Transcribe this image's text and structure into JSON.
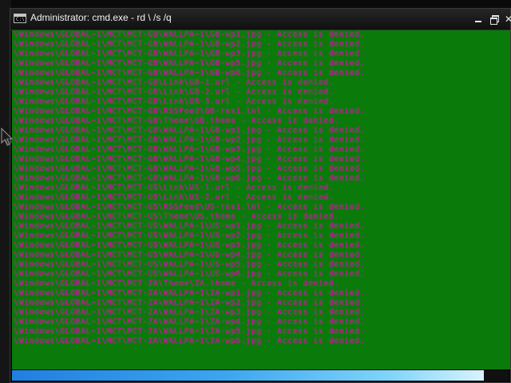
{
  "window": {
    "title": "Administrator: cmd.exe - rd \\ /s /q",
    "app_icon_text": "C:\\",
    "controls": {
      "minimize": "minimize-icon",
      "maximize": "maximize-icon",
      "close": "close-icon"
    }
  },
  "console": {
    "text_color": "#b0168a",
    "background_color": "#0a7a0a",
    "lines": [
      "\\Windows\\GLOBAL~1\\MCT\\MCT-GB\\WALLPA~1\\GB-wp1.jpg - Access is denied.",
      "\\Windows\\GLOBAL~1\\MCT\\MCT-GB\\WALLPA~1\\GB-wp2.jpg - Access is denied.",
      "\\Windows\\GLOBAL~1\\MCT\\MCT-GB\\WALLPA~1\\GB-wp3.jpg - Access is denied.",
      "\\Windows\\GLOBAL~1\\MCT\\MCT-GB\\WALLPA~1\\GB-wp5.jpg - Access is denied.",
      "\\Windows\\GLOBAL~1\\MCT\\MCT-GB\\WALLPA~1\\GB-wp6.jpg - Access is denied.",
      "\\Windows\\GLOBAL~1\\MCT\\MCT-GB\\Link\\GB-1.url - Access is denied.",
      "\\Windows\\GLOBAL~1\\MCT\\MCT-GB\\Link\\GB-2.url - Access is denied.",
      "\\Windows\\GLOBAL~1\\MCT\\MCT-GB\\Link\\GB-3.url - Access is denied.",
      "\\Windows\\GLOBAL~1\\MCT\\MCT-GB\\RSSFeed\\GB-rss1.lnl - Access is denied.",
      "\\Windows\\GLOBAL~1\\MCT\\MCT-GB\\Theme\\GB.theme - Access is denied.",
      "\\Windows\\GLOBAL~1\\MCT\\MCT-GB\\WALLPA~1\\GB-wp1.jpg - Access is denied.",
      "\\Windows\\GLOBAL~1\\MCT\\MCT-GB\\WALLPA~1\\GB-wp2.jpg - Access is denied.",
      "\\Windows\\GLOBAL~1\\MCT\\MCT-GB\\WALLPA~1\\GB-wp3.jpg - Access is denied.",
      "\\Windows\\GLOBAL~1\\MCT\\MCT-GB\\WALLPA~1\\GB-wp4.jpg - Access is denied.",
      "\\Windows\\GLOBAL~1\\MCT\\MCT-GB\\WALLPA~1\\GB-wp5.jpg - Access is denied.",
      "\\Windows\\GLOBAL~1\\MCT\\MCT-GB\\WALLPA~1\\GB-wp6.jpg - Access is denied.",
      "\\Windows\\GLOBAL~1\\MCT\\MCT-US\\Link\\US-1.url - Access is denied.",
      "\\Windows\\GLOBAL~1\\MCT\\MCT-US\\Link\\US-2.url - Access is denied.",
      "\\Windows\\GLOBAL~1\\MCT\\MCT-US\\RSSFeed\\US-rss1.lnl - Access is denied.",
      "\\Windows\\GLOBAL~1\\MCT\\MCT-US\\Theme\\US.theme - Access is denied.",
      "\\Windows\\GLOBAL~1\\MCT\\MCT-US\\WALLPA~1\\US-wp1.jpg - Access is denied.",
      "\\Windows\\GLOBAL~1\\MCT\\MCT-US\\WALLPA~1\\US-wp2.jpg - Access is denied.",
      "\\Windows\\GLOBAL~1\\MCT\\MCT-US\\WALLPA~1\\US-wp3.jpg - Access is denied.",
      "\\Windows\\GLOBAL~1\\MCT\\MCT-US\\WALLPA~1\\US-wp4.jpg - Access is denied.",
      "\\Windows\\GLOBAL~1\\MCT\\MCT-US\\WALLPA~1\\US-wp5.jpg - Access is denied.",
      "\\Windows\\GLOBAL~1\\MCT\\MCT-US\\WALLPA~1\\US-wp6.jpg - Access is denied.",
      "\\Windows\\GLOBAL~1\\MCT\\MCT-ZA\\Theme\\ZA.theme - Access is denied.",
      "\\Windows\\GLOBAL~1\\MCT\\MCT-ZA\\WALLPA~1\\ZA-wp1.jpg - Access is denied.",
      "\\Windows\\GLOBAL~1\\MCT\\MCT-ZA\\WALLPA~1\\ZA-wp2.jpg - Access is denied.",
      "\\Windows\\GLOBAL~1\\MCT\\MCT-ZA\\WALLPA~1\\ZA-wp3.jpg - Access is denied.",
      "\\Windows\\GLOBAL~1\\MCT\\MCT-ZA\\WALLPA~1\\ZA-wp4.jpg - Access is denied.",
      "\\Windows\\GLOBAL~1\\MCT\\MCT-ZA\\WALLPA~1\\ZA-wp5.jpg - Access is denied.",
      "\\Windows\\GLOBAL~1\\MCT\\MCT-ZA\\WALLPA~1\\ZA-wp6.jpg - Access is denied."
    ]
  },
  "progress": {
    "fraction": 0.95,
    "colors": [
      "#1f7fe0",
      "#7fd4fa"
    ]
  },
  "icons": {
    "mouse_cursor": "mouse-pointer-icon"
  }
}
